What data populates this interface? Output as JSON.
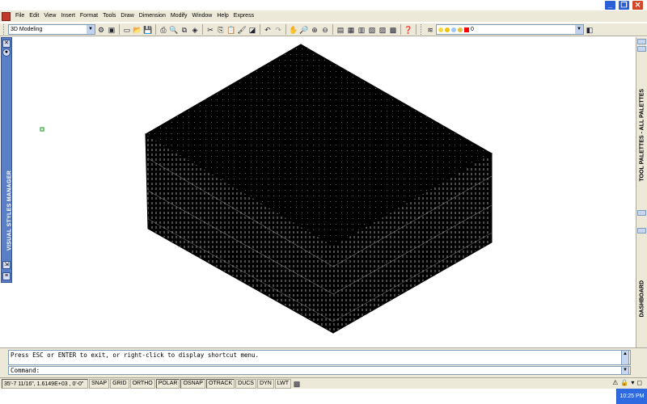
{
  "menu": {
    "items": [
      "File",
      "Edit",
      "View",
      "Insert",
      "Format",
      "Tools",
      "Draw",
      "Dimension",
      "Modify",
      "Window",
      "Help",
      "Express"
    ]
  },
  "window_controls": {
    "minimize": "_",
    "restore": "❐",
    "close": "✕"
  },
  "toolbar": {
    "workspace_value": "3D Modeling",
    "layer_value": "0",
    "icons": [
      "workspace-settings-icon",
      "my-workspace-icon",
      "qnew-icon",
      "open-icon",
      "save-icon",
      "plot-icon",
      "plot-preview-icon",
      "publish-icon",
      "3d-dwf-icon",
      "cut-icon",
      "copy-icon",
      "paste-icon",
      "match-properties-icon",
      "block-editor-icon",
      "undo-icon",
      "redo-icon",
      "pan-icon",
      "zoom-realtime-icon",
      "zoom-window-icon",
      "zoom-previous-icon",
      "properties-icon",
      "design-center-icon",
      "tool-palettes-icon",
      "sheet-set-icon",
      "markup-icon",
      "quickcalc-icon",
      "help-icon",
      "layer-properties-icon"
    ]
  },
  "left_panel": {
    "title": "VISUAL STYLES MANAGER"
  },
  "right_panel": {
    "title_top": "TOOL PALETTES - ALL PALETTES",
    "title_bottom": "DASHBOARD"
  },
  "command": {
    "history": "Press ESC or ENTER to exit, or right-click to display shortcut menu.",
    "prompt": "Command:"
  },
  "status": {
    "coordinates": "35'-7 11/16\", 1.6149E+03 , 0'-0\"",
    "toggles": [
      "SNAP",
      "GRID",
      "ORTHO",
      "POLAR",
      "OSNAP",
      "OTRACK",
      "DUCS",
      "DYN",
      "LWT"
    ]
  },
  "taskbar": {
    "clock": "10:25 PM"
  },
  "colors": {
    "titlebar": "#ffffff",
    "panel_blue": "#5b7fc7",
    "toolbar": "#ece9d8",
    "clock_bg": "#2f6be0"
  }
}
